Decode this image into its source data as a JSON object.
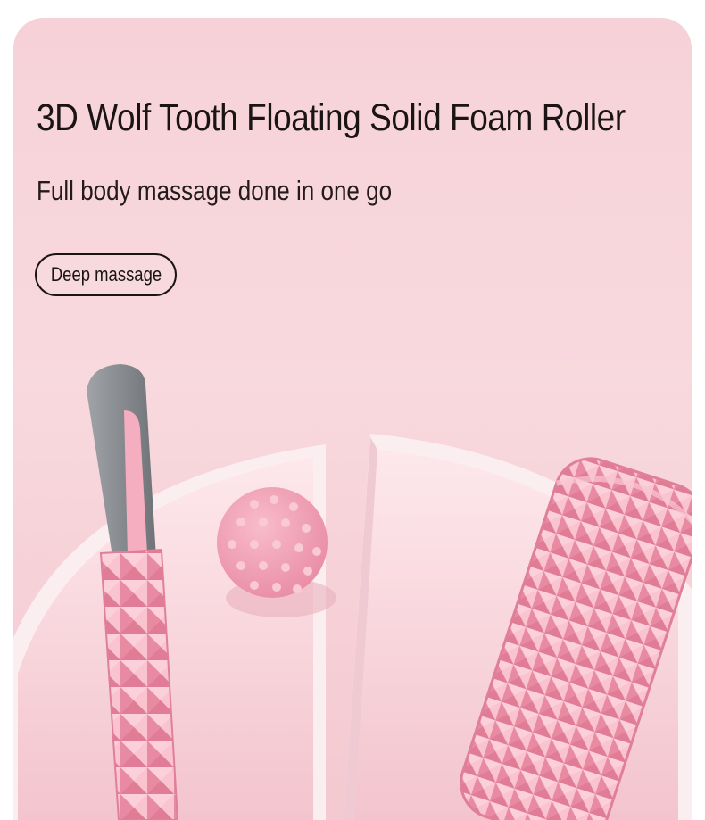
{
  "headline": {
    "title": "3D Wolf Tooth Floating Solid Foam Roller",
    "subtitle": "Full body massage done in one go"
  },
  "badge": {
    "label": "Deep massage"
  },
  "colors": {
    "background": "#f6d2d8",
    "product_pink": "#f0a3b6",
    "handle_grey": "#8b8f93",
    "text": "#1b1415"
  },
  "products": [
    "massage-stick",
    "spiky-massage-ball",
    "wolf-tooth-foam-roller"
  ]
}
